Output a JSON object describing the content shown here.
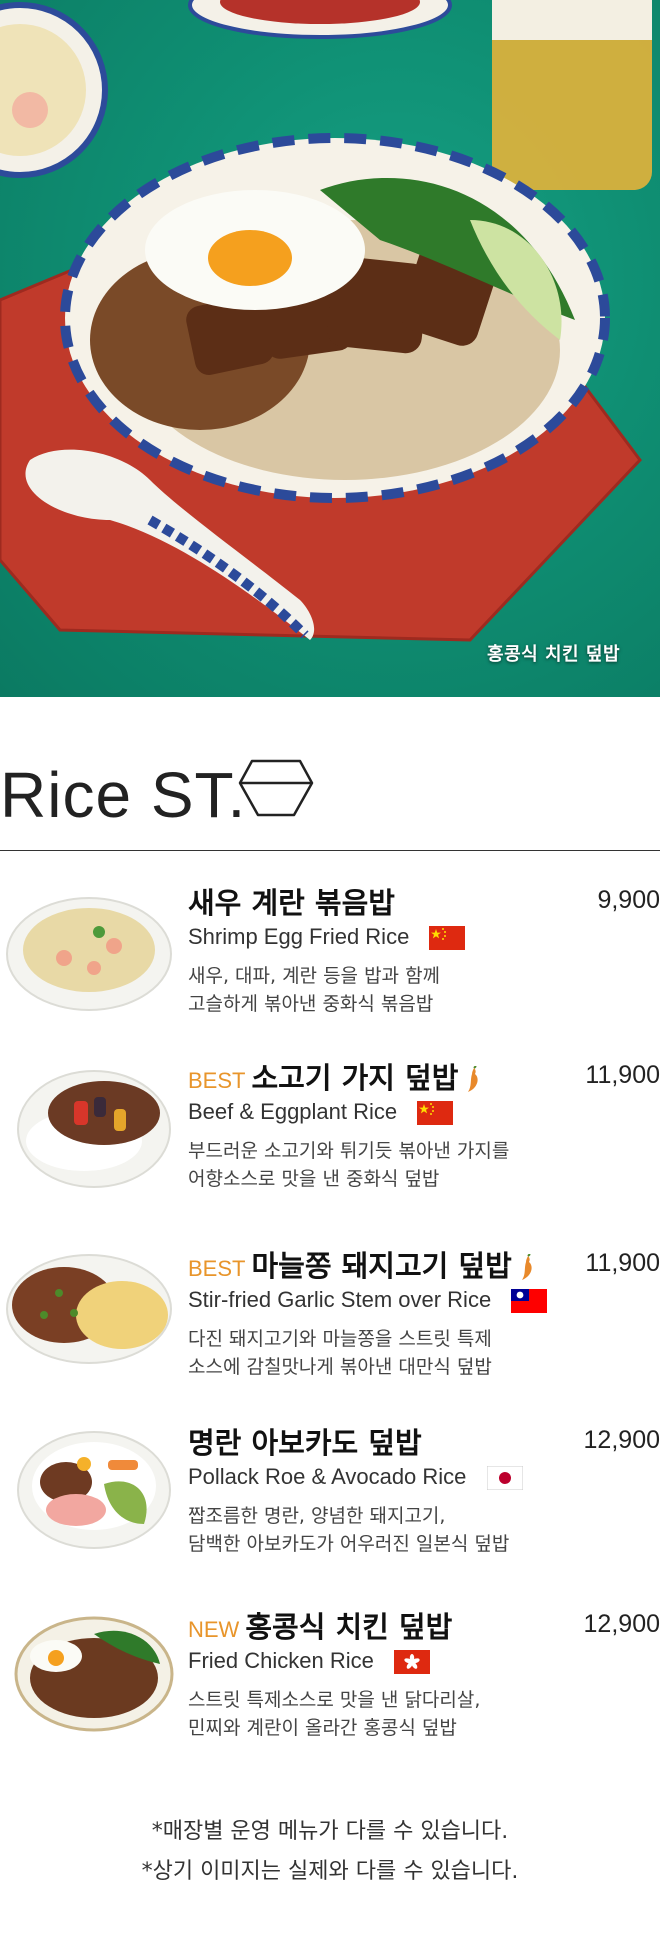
{
  "hero": {
    "caption": "홍콩식 치킨 덮밥"
  },
  "section": {
    "title": "Rice ST.",
    "icon": "bowl-outline-icon"
  },
  "items": [
    {
      "badge": "",
      "name": "새우 계란 볶음밥",
      "price": "9,900",
      "english": "Shrimp Egg Fried Rice",
      "flag": "china-flag-icon",
      "spicy": false,
      "desc1": "새우, 대파, 계란 등을 밥과 함께",
      "desc2": "고슬하게 볶아낸 중화식 볶음밥"
    },
    {
      "badge": "BEST",
      "name": "소고기 가지 덮밥",
      "price": "11,900",
      "english": "Beef & Eggplant Rice",
      "flag": "china-flag-icon",
      "spicy": true,
      "desc1": "부드러운 소고기와 튀기듯 볶아낸 가지를",
      "desc2": "어향소스로 맛을 낸 중화식 덮밥"
    },
    {
      "badge": "BEST",
      "name": "마늘쫑 돼지고기 덮밥",
      "price": "11,900",
      "english": "Stir-fried Garlic Stem over Rice",
      "flag": "taiwan-flag-icon",
      "spicy": true,
      "desc1": "다진 돼지고기와 마늘쫑을 스트릿 특제",
      "desc2": "소스에 감칠맛나게 볶아낸 대만식 덮밥"
    },
    {
      "badge": "",
      "name": "명란 아보카도 덮밥",
      "price": "12,900",
      "english": "Pollack Roe & Avocado Rice",
      "flag": "japan-flag-icon",
      "spicy": false,
      "desc1": "짭조름한 명란, 양념한 돼지고기,",
      "desc2": "담백한 아보카도가 어우러진 일본식 덮밥"
    },
    {
      "badge": "NEW",
      "name": "홍콩식 치킨 덮밥",
      "price": "12,900",
      "english": "Fried Chicken Rice",
      "flag": "hongkong-flag-icon",
      "spicy": false,
      "desc1": "스트릿 특제소스로 맛을 낸 닭다리살,",
      "desc2": "민찌와 계란이 올라간 홍콩식 덮밥"
    }
  ],
  "footnotes": [
    "*매장별 운영 메뉴가 다를 수 있습니다.",
    "*상기 이미지는 실제와 다를 수 있습니다."
  ]
}
